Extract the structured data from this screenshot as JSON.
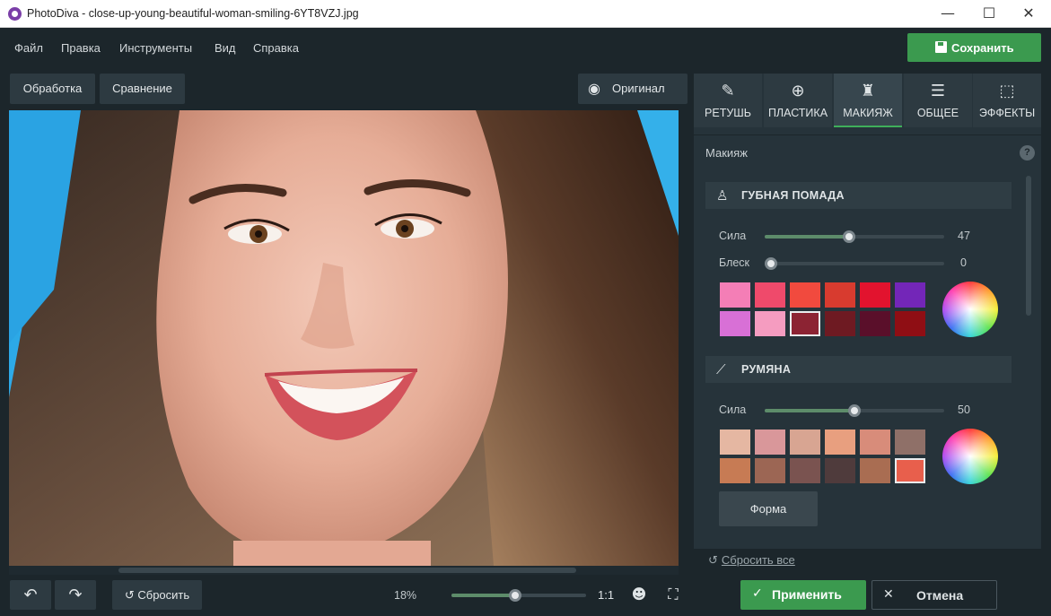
{
  "window": {
    "app_name": "PhotoDiva",
    "title": "PhotoDiva - close-up-young-beautiful-woman-smiling-6YT8VZJ.jpg",
    "minimize_glyph": "—",
    "maximize_glyph": "☐",
    "close_glyph": "✕"
  },
  "menu": {
    "items": [
      "Файл",
      "Правка",
      "Инструменты",
      "Вид",
      "Справка"
    ],
    "save_label": "Сохранить"
  },
  "toolbar": {
    "processing_label": "Обработка",
    "compare_label": "Сравнение",
    "original_label": "Оригинал"
  },
  "tabs": [
    {
      "label": "РЕТУШЬ",
      "icon": "brush-icon",
      "active": false
    },
    {
      "label": "ПЛАСТИКА",
      "icon": "globe-icon",
      "active": false
    },
    {
      "label": "МАКИЯЖ",
      "icon": "makeup-icon",
      "active": true
    },
    {
      "label": "ОБЩЕЕ",
      "icon": "sliders-icon",
      "active": false
    },
    {
      "label": "ЭФФЕКТЫ",
      "icon": "effects-icon",
      "active": false
    }
  ],
  "panel": {
    "title": "Макияж",
    "help": "?",
    "lipstick": {
      "title": "ГУБНАЯ ПОМАДА",
      "strength_label": "Сила",
      "strength_value": "47",
      "shine_label": "Блеск",
      "shine_value": "0",
      "swatches": [
        "#f47eb6",
        "#ef4a6b",
        "#f14a3e",
        "#d83b2f",
        "#e2132e",
        "#7326b8",
        "#d870d6",
        "#f59cc0",
        "#8c2333",
        "#6e1a22",
        "#5a0f2a",
        "#8f0e14"
      ],
      "selected_index": 8
    },
    "blush": {
      "title": "РУМЯНА",
      "strength_label": "Сила",
      "strength_value": "50",
      "swatches": [
        "#e5b7a2",
        "#d9979a",
        "#d8a592",
        "#e89f7f",
        "#d88c7a",
        "#8f7068",
        "#c77b54",
        "#9c6654",
        "#7a5350",
        "#4f3b3c",
        "#a96d52",
        "#e85f4c"
      ],
      "selected_index": 11,
      "shape_label": "Форма"
    },
    "reset_all_label": "Сбросить все"
  },
  "bottom": {
    "reset_label": "Сбросить",
    "zoom_value": "18%",
    "zoom_one_to_one": "1:1",
    "apply_label": "Применить",
    "cancel_label": "Отмена"
  },
  "colors": {
    "accent_green": "#3b9a4f",
    "background": "#1c262b",
    "panel": "#26333a"
  }
}
